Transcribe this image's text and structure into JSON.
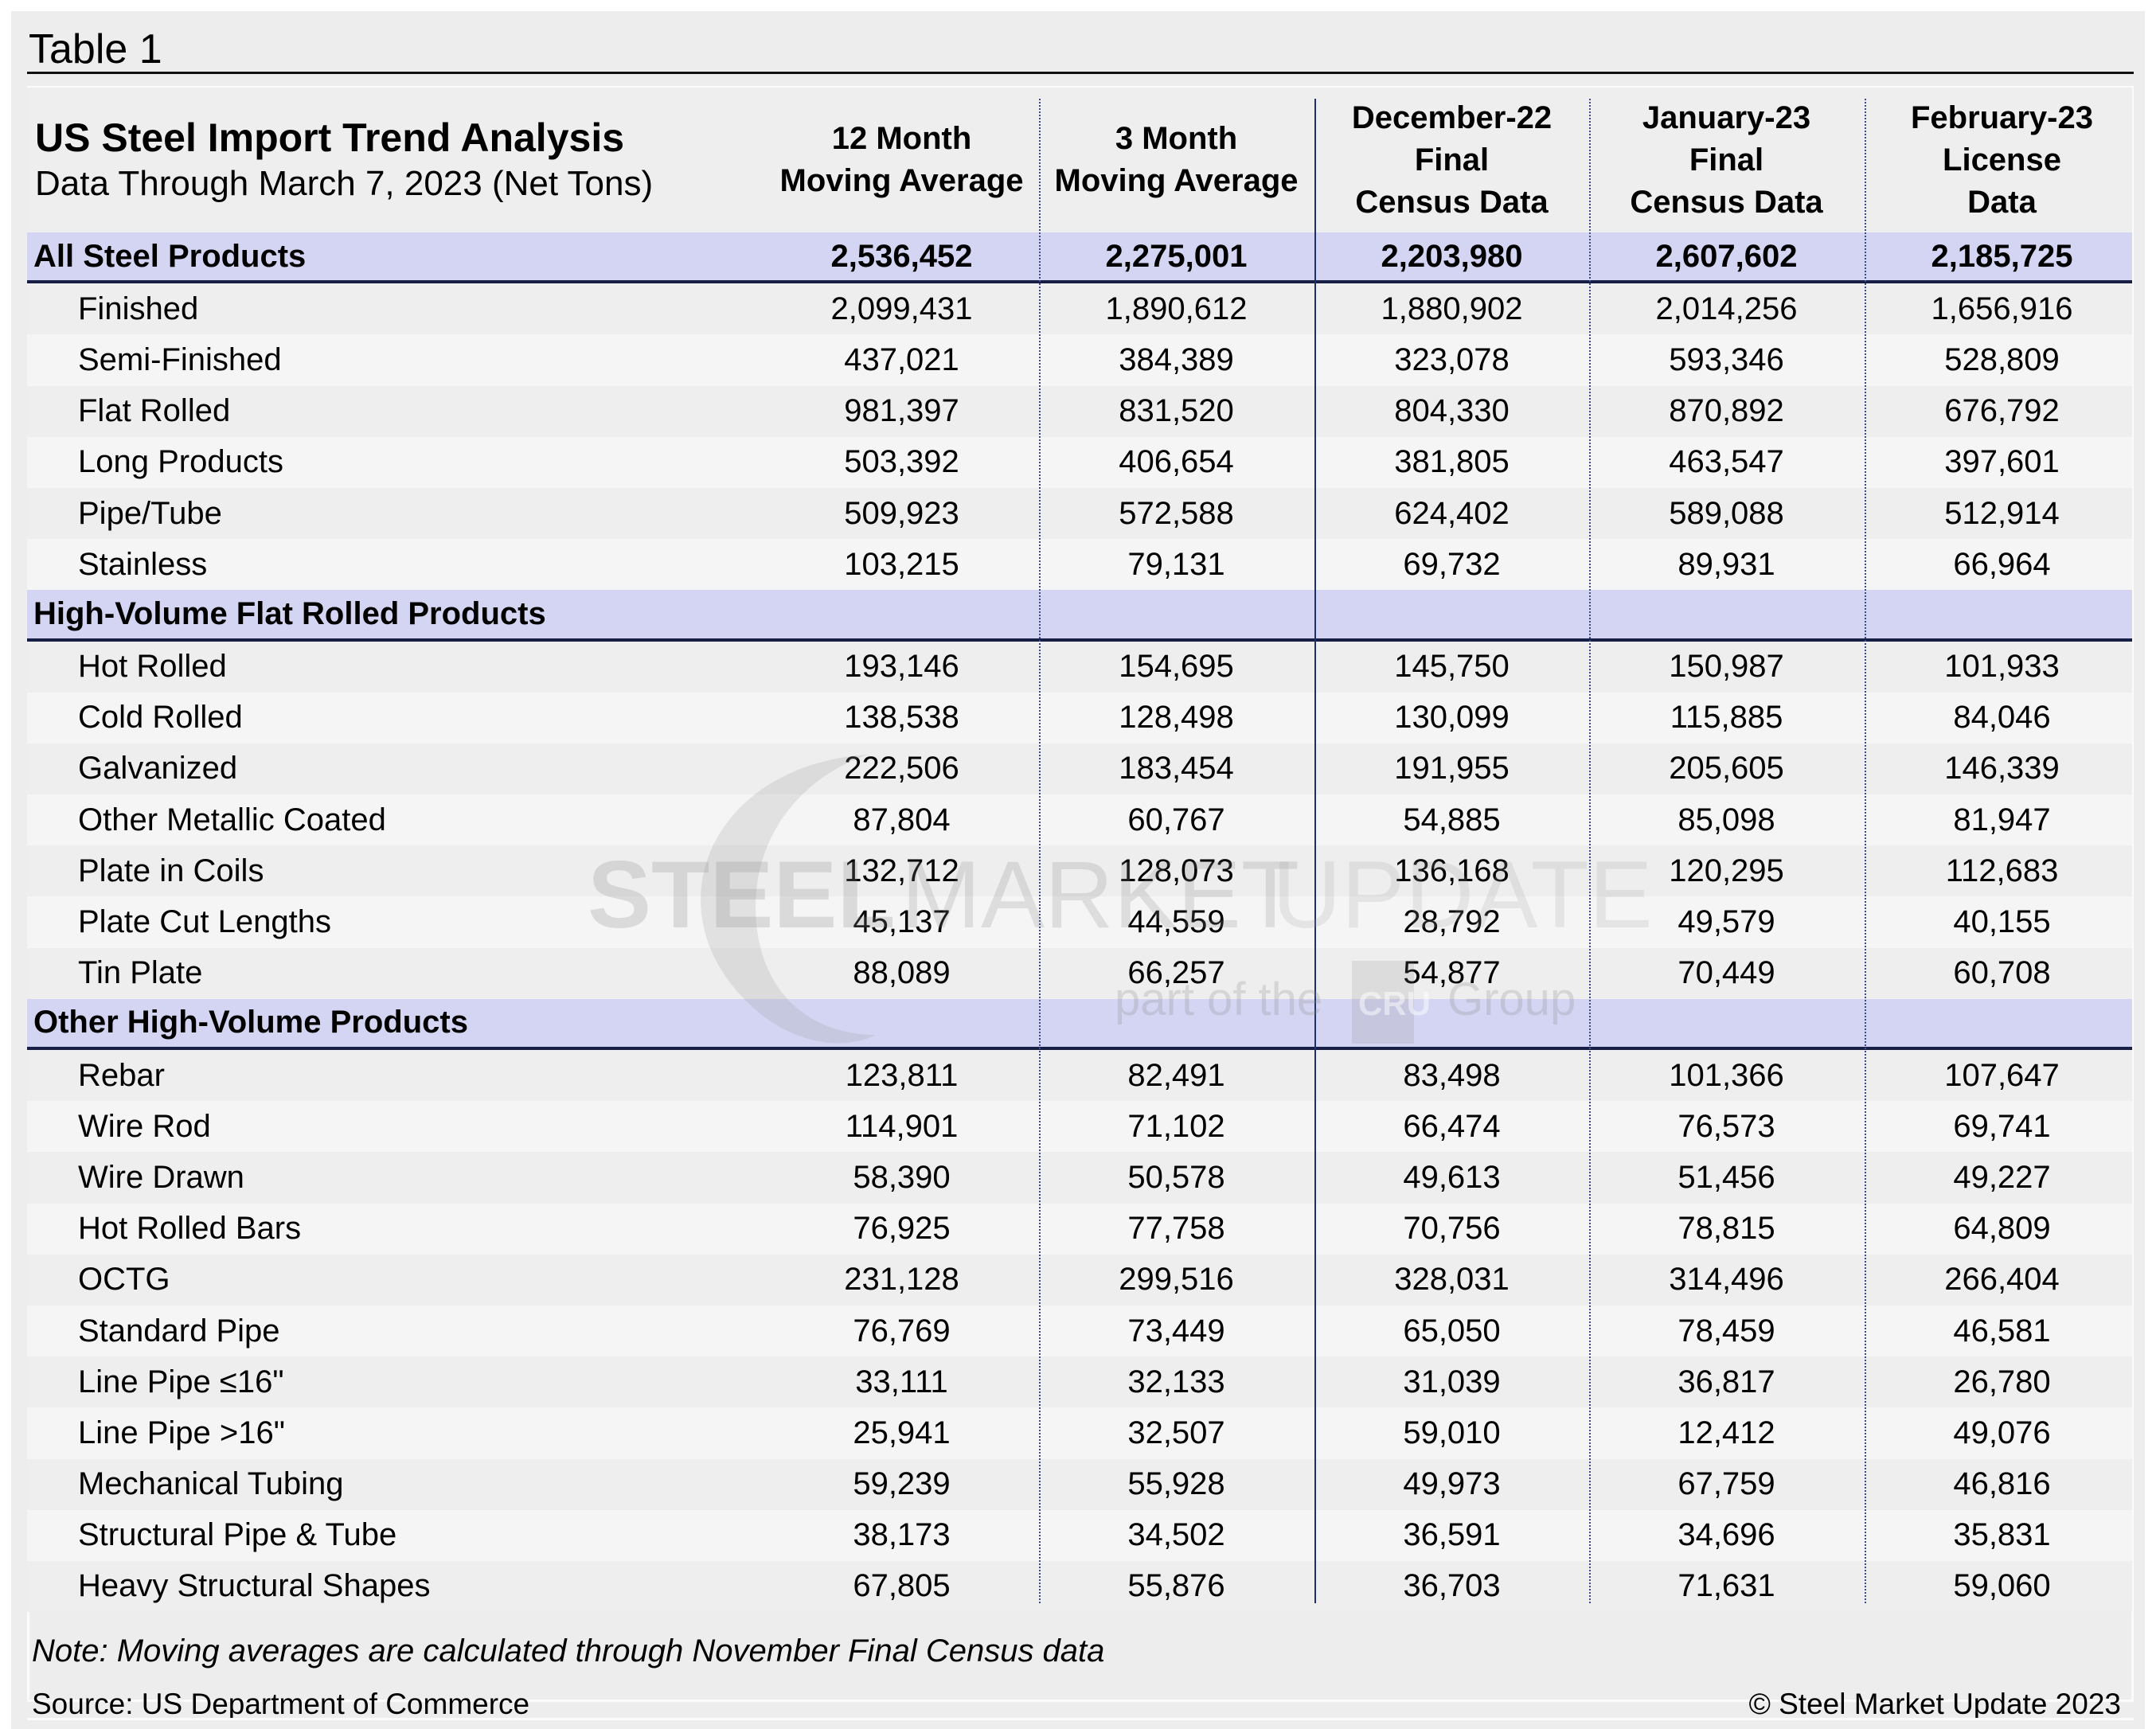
{
  "table_label": "Table 1",
  "header": {
    "title": "US Steel Import Trend Analysis",
    "subtitle": "Data Through March 7, 2023 (Net Tons)",
    "columns": [
      {
        "lines": [
          "12 Month",
          "Moving Average"
        ]
      },
      {
        "lines": [
          "3 Month",
          "Moving Average"
        ]
      },
      {
        "lines": [
          "December-22",
          "Final",
          "Census Data"
        ]
      },
      {
        "lines": [
          "January-23",
          "Final",
          "Census Data"
        ]
      },
      {
        "lines": [
          "February-23",
          "License",
          "Data"
        ]
      }
    ]
  },
  "sections": [
    {
      "name": "All Steel Products",
      "totals": [
        "2,536,452",
        "2,275,001",
        "2,203,980",
        "2,607,602",
        "2,185,725"
      ],
      "rows": [
        {
          "label": "Finished",
          "values": [
            "2,099,431",
            "1,890,612",
            "1,880,902",
            "2,014,256",
            "1,656,916"
          ]
        },
        {
          "label": "Semi-Finished",
          "values": [
            "437,021",
            "384,389",
            "323,078",
            "593,346",
            "528,809"
          ]
        },
        {
          "label": "Flat Rolled",
          "values": [
            "981,397",
            "831,520",
            "804,330",
            "870,892",
            "676,792"
          ]
        },
        {
          "label": "Long Products",
          "values": [
            "503,392",
            "406,654",
            "381,805",
            "463,547",
            "397,601"
          ]
        },
        {
          "label": "Pipe/Tube",
          "values": [
            "509,923",
            "572,588",
            "624,402",
            "589,088",
            "512,914"
          ]
        },
        {
          "label": "Stainless",
          "values": [
            "103,215",
            "79,131",
            "69,732",
            "89,931",
            "66,964"
          ]
        }
      ]
    },
    {
      "name": "High-Volume Flat Rolled Products",
      "totals": [
        "",
        "",
        "",
        "",
        ""
      ],
      "rows": [
        {
          "label": "Hot Rolled",
          "values": [
            "193,146",
            "154,695",
            "145,750",
            "150,987",
            "101,933"
          ]
        },
        {
          "label": "Cold Rolled",
          "values": [
            "138,538",
            "128,498",
            "130,099",
            "115,885",
            "84,046"
          ]
        },
        {
          "label": "Galvanized",
          "values": [
            "222,506",
            "183,454",
            "191,955",
            "205,605",
            "146,339"
          ]
        },
        {
          "label": "Other Metallic Coated",
          "values": [
            "87,804",
            "60,767",
            "54,885",
            "85,098",
            "81,947"
          ]
        },
        {
          "label": "Plate in Coils",
          "values": [
            "132,712",
            "128,073",
            "136,168",
            "120,295",
            "112,683"
          ]
        },
        {
          "label": "Plate Cut Lengths",
          "values": [
            "45,137",
            "44,559",
            "28,792",
            "49,579",
            "40,155"
          ]
        },
        {
          "label": "Tin Plate",
          "values": [
            "88,089",
            "66,257",
            "54,877",
            "70,449",
            "60,708"
          ]
        }
      ]
    },
    {
      "name": "Other High-Volume Products",
      "totals": [
        "",
        "",
        "",
        "",
        ""
      ],
      "rows": [
        {
          "label": "Rebar",
          "values": [
            "123,811",
            "82,491",
            "83,498",
            "101,366",
            "107,647"
          ]
        },
        {
          "label": "Wire Rod",
          "values": [
            "114,901",
            "71,102",
            "66,474",
            "76,573",
            "69,741"
          ]
        },
        {
          "label": "Wire Drawn",
          "values": [
            "58,390",
            "50,578",
            "49,613",
            "51,456",
            "49,227"
          ]
        },
        {
          "label": "Hot Rolled Bars",
          "values": [
            "76,925",
            "77,758",
            "70,756",
            "78,815",
            "64,809"
          ]
        },
        {
          "label": "OCTG",
          "values": [
            "231,128",
            "299,516",
            "328,031",
            "314,496",
            "266,404"
          ]
        },
        {
          "label": "Standard Pipe",
          "values": [
            "76,769",
            "73,449",
            "65,050",
            "78,459",
            "46,581"
          ]
        },
        {
          "label": "Line Pipe ≤16\"",
          "values": [
            "33,111",
            "32,133",
            "31,039",
            "36,817",
            "26,780"
          ]
        },
        {
          "label": "Line Pipe >16\"",
          "values": [
            "25,941",
            "32,507",
            "59,010",
            "12,412",
            "49,076"
          ]
        },
        {
          "label": "Mechanical Tubing",
          "values": [
            "59,239",
            "55,928",
            "49,973",
            "67,759",
            "46,816"
          ]
        },
        {
          "label": "Structural Pipe & Tube",
          "values": [
            "38,173",
            "34,502",
            "36,591",
            "34,696",
            "35,831"
          ]
        },
        {
          "label": "Heavy Structural Shapes",
          "values": [
            "67,805",
            "55,876",
            "36,703",
            "71,631",
            "59,060"
          ]
        }
      ]
    }
  ],
  "footer": {
    "note": "Note: Moving averages are calculated through November Final Census data",
    "source": "Source: US Department of Commerce",
    "copyright": "© Steel Market Update 2023"
  },
  "watermark": {
    "word1": "STEEL",
    "word2": "MARKET",
    "word3": "UPDATE",
    "tagline_pre": "part of the",
    "tagline_logo": "CRU",
    "tagline_post": "Group"
  },
  "colors": {
    "section_band": "#d3d5f2",
    "rule_navy": "#172044",
    "background": "#ededed"
  }
}
